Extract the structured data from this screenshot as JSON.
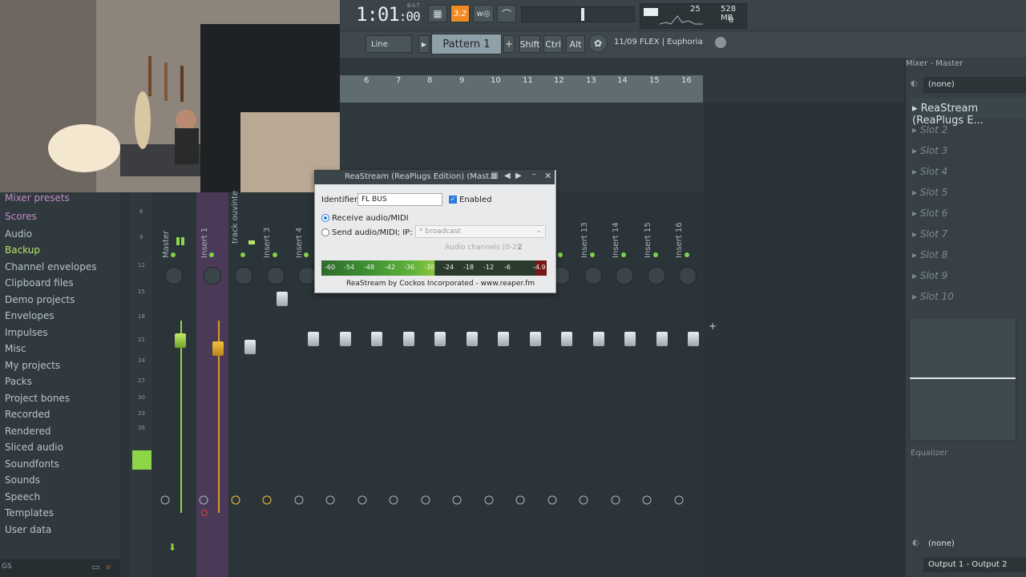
{
  "toolbar": {
    "time_main": "1:01",
    "time_sub": ":00",
    "time_label": "B:S:T",
    "tempo_label": "3.2",
    "cpu": "25",
    "ram": "528 MB",
    "voices": "0",
    "snap": "Line",
    "pattern": "Pattern 1",
    "shift": "Shift",
    "ctrl": "Ctrl",
    "alt": "Alt",
    "news": "11/09  FLEX | Euphoria"
  },
  "mixer": {
    "title": "Mixer - Master",
    "columns": [
      "6",
      "7",
      "8",
      "9",
      "10",
      "11",
      "12",
      "13",
      "14",
      "15",
      "16"
    ],
    "db_scale": [
      "6",
      "9",
      "12",
      "15",
      "18",
      "21",
      "24",
      "27",
      "30",
      "33",
      "36"
    ],
    "strips": [
      "Master",
      "Insert 1",
      "track ouvinte",
      "Insert 3",
      "Insert 4",
      "",
      "",
      "",
      "",
      "",
      "",
      "",
      "",
      "Insert 13",
      "Insert 14",
      "Insert 15",
      "Insert 16"
    ]
  },
  "browser": {
    "items": [
      "Mixer presets",
      "Scores",
      "Audio",
      "Backup",
      "Channel envelopes",
      "Clipboard files",
      "Demo projects",
      "Envelopes",
      "Impulses",
      "Misc",
      "My projects",
      "Packs",
      "Project bones",
      "Recorded",
      "Rendered",
      "Sliced audio",
      "Soundfonts",
      "Sounds",
      "Speech",
      "Templates",
      "User data"
    ],
    "footer": "GS"
  },
  "right_panel": {
    "preset": "(none)",
    "slot_active": "ReaStream (ReaPlugs E...",
    "slots": [
      "Slot 2",
      "Slot 3",
      "Slot 4",
      "Slot 5",
      "Slot 6",
      "Slot 7",
      "Slot 8",
      "Slot 9",
      "Slot 10"
    ],
    "eq_label": "Equalizer",
    "out_preset": "(none)",
    "output": "Output 1 - Output 2"
  },
  "plugin": {
    "title": "ReaStream (ReaPlugs Edition) (Mast...",
    "identifier_label": "Identifier:",
    "identifier_value": "FL BUS",
    "enabled_label": "Enabled",
    "receive_label": "Receive audio/MIDI",
    "send_label": "Send audio/MIDI; IP:",
    "ip_value": "* broadcast",
    "channels_label": "Audio channels (0-2):",
    "channels_value": "2",
    "meter_ticks": [
      "-60",
      "-54",
      "-48",
      "-42",
      "-36",
      "-30",
      "-24",
      "-18",
      "-12",
      "-6",
      "-4.9"
    ],
    "footer": "ReaStream by Cockos Incorporated - www.reaper.fm"
  }
}
